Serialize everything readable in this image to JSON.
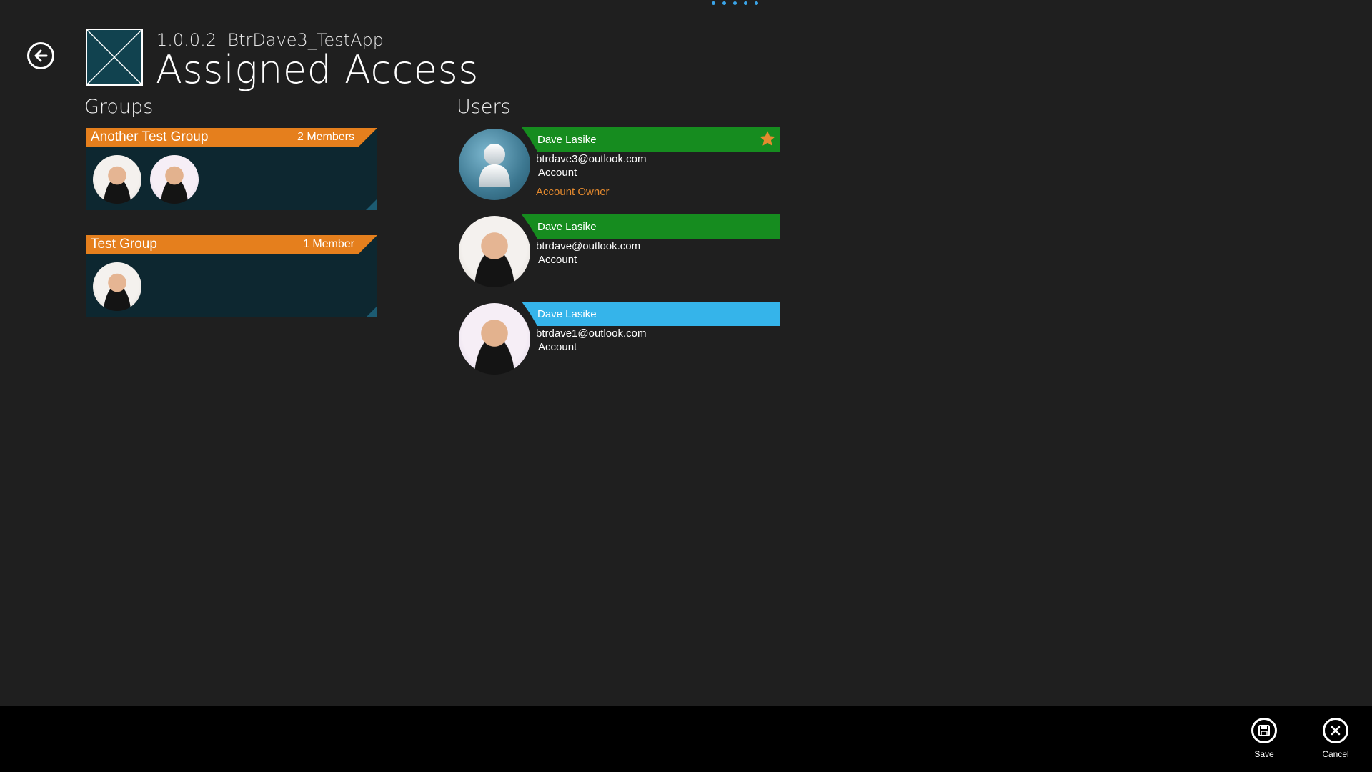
{
  "header": {
    "subtitle": "1.0.0.2 -BtrDave3_TestApp",
    "title": "Assigned Access"
  },
  "groups": {
    "heading": "Groups",
    "items": [
      {
        "name": "Another Test Group",
        "count": "2 Members"
      },
      {
        "name": "Test Group",
        "count": "1 Member"
      }
    ]
  },
  "users": {
    "heading": "Users",
    "items": [
      {
        "name": "Dave Lasike",
        "email": "btrdave3@outlook.com",
        "type": "Account",
        "role": "Account Owner",
        "header_color": "#168c1f",
        "avatar": "default-user-icon"
      },
      {
        "name": "Dave Lasike",
        "email": "btrdave@outlook.com",
        "type": "Account",
        "header_color": "#168c1f",
        "avatar": "baby-photo"
      },
      {
        "name": "Dave Lasike",
        "email": "btrdave1@outlook.com",
        "type": "Account",
        "header_color": "#35b4ea",
        "avatar": "baby-photo"
      }
    ]
  },
  "appbar": {
    "save_label": "Save",
    "cancel_label": "Cancel"
  },
  "colors": {
    "background": "#1f1f1f",
    "group_header": "#e57f1d",
    "group_body": "#0d2730",
    "owner_star": "#e58a2e",
    "role_text": "#e58a2e"
  }
}
